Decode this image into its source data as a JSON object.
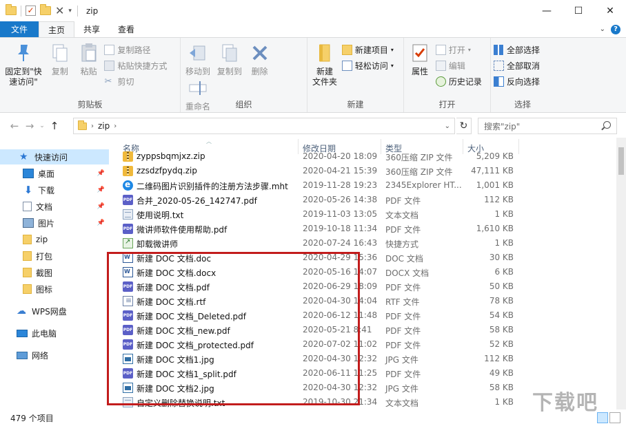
{
  "window": {
    "title": "zip",
    "controls": {
      "minimize": "—",
      "maximize": "☐",
      "close": "✕"
    }
  },
  "ribbon_tabs": [
    {
      "label": "文件"
    },
    {
      "label": "主页"
    },
    {
      "label": "共享"
    },
    {
      "label": "查看"
    }
  ],
  "ribbon": {
    "clipboard": {
      "label": "剪贴板",
      "pin": "固定到\"快\n速访问\"",
      "copy": "复制",
      "paste": "粘贴",
      "copy_path": "复制路径",
      "paste_shortcut": "粘贴快捷方式",
      "cut": "剪切"
    },
    "organize": {
      "label": "组织",
      "move_to": "移动到",
      "copy_to": "复制到",
      "delete": "删除",
      "rename": "重命名"
    },
    "new": {
      "label": "新建",
      "new_folder": "新建\n文件夹",
      "new_item": "新建项目",
      "easy_access": "轻松访问"
    },
    "open": {
      "label": "打开",
      "properties": "属性",
      "open": "打开",
      "edit": "编辑",
      "history": "历史记录"
    },
    "select": {
      "label": "选择",
      "select_all": "全部选择",
      "select_none": "全部取消",
      "invert": "反向选择"
    }
  },
  "address": {
    "path": "zip",
    "search_placeholder": "搜索\"zip\""
  },
  "nav": [
    {
      "label": "快速访问",
      "icon": "star-icon",
      "pinned": false,
      "selected": true
    },
    {
      "label": "桌面",
      "icon": "desktop-icon",
      "pinned": true
    },
    {
      "label": "下载",
      "icon": "download-icon",
      "pinned": true
    },
    {
      "label": "文档",
      "icon": "document-icon",
      "pinned": true
    },
    {
      "label": "图片",
      "icon": "picture-icon",
      "pinned": true
    },
    {
      "label": "zip",
      "icon": "folder-icon",
      "pinned": false
    },
    {
      "label": "打包",
      "icon": "folder-icon",
      "pinned": false
    },
    {
      "label": "截图",
      "icon": "folder-icon",
      "pinned": false
    },
    {
      "label": "图标",
      "icon": "folder-icon",
      "pinned": false
    },
    {
      "label": "WPS网盘",
      "icon": "cloud-icon",
      "pinned": false
    },
    {
      "label": "此电脑",
      "icon": "computer-icon",
      "pinned": false
    },
    {
      "label": "网络",
      "icon": "network-icon",
      "pinned": false
    }
  ],
  "columns": {
    "name": "名称",
    "date": "修改日期",
    "type": "类型",
    "size": "大小"
  },
  "files": [
    {
      "name": "zyppsbqmjxz.zip",
      "date": "2020-04-20 18:09",
      "type": "360压缩 ZIP 文件",
      "size": "5,209 KB",
      "icon": "zip"
    },
    {
      "name": "zzsdzfpydq.zip",
      "date": "2020-04-21 15:39",
      "type": "360压缩 ZIP 文件",
      "size": "47,111 KB",
      "icon": "zip"
    },
    {
      "name": "二维码图片识别插件的注册方法步骤.mht",
      "date": "2019-11-28 19:23",
      "type": "2345Explorer HT...",
      "size": "1,001 KB",
      "icon": "mht"
    },
    {
      "name": "合并_2020-05-26_142747.pdf",
      "date": "2020-05-26 14:38",
      "type": "PDF 文件",
      "size": "112 KB",
      "icon": "pdf"
    },
    {
      "name": "使用说明.txt",
      "date": "2019-11-03 13:05",
      "type": "文本文档",
      "size": "1 KB",
      "icon": "txt"
    },
    {
      "name": "微讲师软件使用帮助.pdf",
      "date": "2019-10-18 11:34",
      "type": "PDF 文件",
      "size": "1,610 KB",
      "icon": "pdf"
    },
    {
      "name": "卸载微讲师",
      "date": "2020-07-24 16:43",
      "type": "快捷方式",
      "size": "1 KB",
      "icon": "lnk"
    },
    {
      "name": "新建 DOC 文档.doc",
      "date": "2020-04-29 15:36",
      "type": "DOC 文档",
      "size": "30 KB",
      "icon": "doc"
    },
    {
      "name": "新建 DOC 文档.docx",
      "date": "2020-05-16 14:07",
      "type": "DOCX 文档",
      "size": "6 KB",
      "icon": "doc"
    },
    {
      "name": "新建 DOC 文档.pdf",
      "date": "2020-06-29 18:09",
      "type": "PDF 文件",
      "size": "50 KB",
      "icon": "pdf"
    },
    {
      "name": "新建 DOC 文档.rtf",
      "date": "2020-04-30 14:04",
      "type": "RTF 文件",
      "size": "78 KB",
      "icon": "rtf"
    },
    {
      "name": "新建 DOC 文档_Deleted.pdf",
      "date": "2020-06-12 11:48",
      "type": "PDF 文件",
      "size": "54 KB",
      "icon": "pdf"
    },
    {
      "name": "新建 DOC 文档_new.pdf",
      "date": "2020-05-21 8:41",
      "type": "PDF 文件",
      "size": "58 KB",
      "icon": "pdf"
    },
    {
      "name": "新建 DOC 文档_protected.pdf",
      "date": "2020-07-02 11:02",
      "type": "PDF 文件",
      "size": "52 KB",
      "icon": "pdf"
    },
    {
      "name": "新建 DOC 文档1.jpg",
      "date": "2020-04-30 12:32",
      "type": "JPG 文件",
      "size": "112 KB",
      "icon": "jpg"
    },
    {
      "name": "新建 DOC 文档1_split.pdf",
      "date": "2020-06-11 11:25",
      "type": "PDF 文件",
      "size": "49 KB",
      "icon": "pdf"
    },
    {
      "name": "新建 DOC 文档2.jpg",
      "date": "2020-04-30 12:32",
      "type": "JPG 文件",
      "size": "58 KB",
      "icon": "jpg"
    },
    {
      "name": "自定义删除替换说明.txt",
      "date": "2019-10-30 21:34",
      "type": "文本文档",
      "size": "1 KB",
      "icon": "txt"
    }
  ],
  "status": {
    "count": "479 个项目"
  },
  "watermark": "下载吧",
  "colors": {
    "accent": "#1979ca",
    "selection": "#cce8ff",
    "highlight_box": "#c21c1c",
    "pdf_icon": "#5b5fc7"
  }
}
